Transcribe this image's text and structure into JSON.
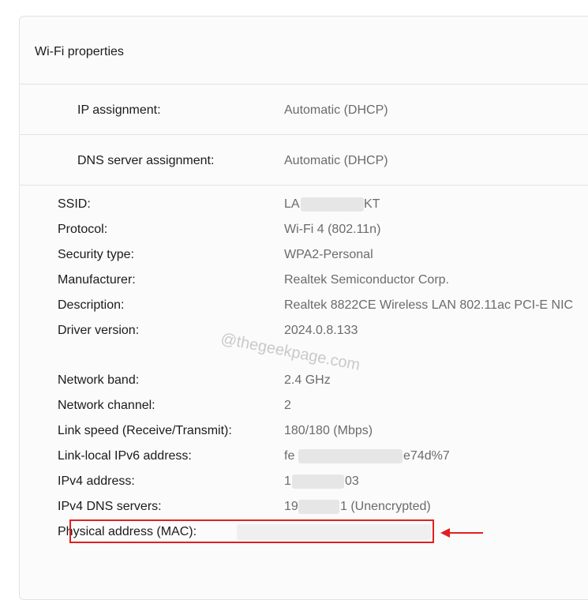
{
  "panel": {
    "title": "Wi-Fi properties"
  },
  "rows": {
    "ip_assignment": {
      "label": "IP assignment:",
      "value": "Automatic (DHCP)"
    },
    "dns_assignment": {
      "label": "DNS server assignment:",
      "value": "Automatic (DHCP)"
    }
  },
  "properties": [
    {
      "label": "SSID:",
      "value": "LA",
      "value_tail": "KT"
    },
    {
      "label": "Protocol:",
      "value": "Wi-Fi 4 (802.11n)"
    },
    {
      "label": "Security type:",
      "value": "WPA2-Personal"
    },
    {
      "label": "Manufacturer:",
      "value": "Realtek Semiconductor Corp."
    },
    {
      "label": "Description:",
      "value": "Realtek 8822CE Wireless LAN 802.11ac PCI-E NIC"
    },
    {
      "label": "Driver version:",
      "value": "2024.0.8.133"
    },
    {
      "label": "Network band:",
      "value": "2.4 GHz"
    },
    {
      "label": "Network channel:",
      "value": "2"
    },
    {
      "label": "Link speed (Receive/Transmit):",
      "value": "180/180 (Mbps)"
    },
    {
      "label": "Link-local IPv6 address:",
      "value": "fe",
      "value_tail": "e74d%7"
    },
    {
      "label": "IPv4 address:",
      "value": "1",
      "value_tail": "03"
    },
    {
      "label": "IPv4 DNS servers:",
      "value": "19",
      "value_tail": "1 (Unencrypted)"
    },
    {
      "label": "Physical address (MAC):",
      "value": ""
    }
  ],
  "watermark": "@thegeekpage.com",
  "colors": {
    "highlight": "#e02020",
    "label_text": "#1b1b1b",
    "value_text": "#6b6b6b"
  }
}
